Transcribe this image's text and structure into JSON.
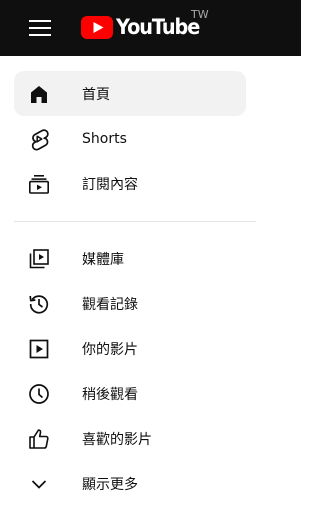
{
  "header": {
    "logo_text": "YouTube",
    "region": "TW"
  },
  "sidebar": {
    "items": [
      {
        "label": "首頁",
        "icon": "home-icon",
        "active": true
      },
      {
        "label": "Shorts",
        "icon": "shorts-icon",
        "active": false
      },
      {
        "label": "訂閱內容",
        "icon": "subscriptions-icon",
        "active": false
      },
      {
        "label": "媒體庫",
        "icon": "library-icon",
        "active": false
      },
      {
        "label": "觀看記錄",
        "icon": "history-icon",
        "active": false
      },
      {
        "label": "你的影片",
        "icon": "your-videos-icon",
        "active": false
      },
      {
        "label": "稍後觀看",
        "icon": "watch-later-icon",
        "active": false
      },
      {
        "label": "喜歡的影片",
        "icon": "liked-videos-icon",
        "active": false
      },
      {
        "label": "顯示更多",
        "icon": "chevron-down-icon",
        "active": false
      }
    ]
  },
  "colors": {
    "topbar": "#0f0f0f",
    "brand_red": "#ff0000",
    "active_bg": "#f2f2f2"
  }
}
